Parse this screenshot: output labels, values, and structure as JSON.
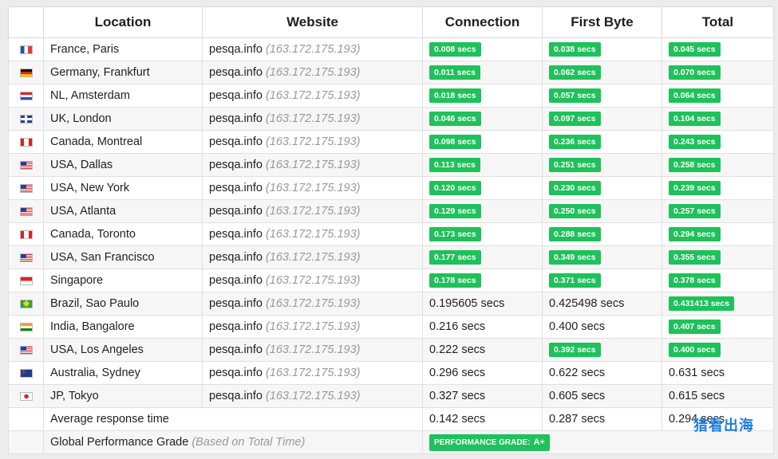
{
  "headers": [
    "Location",
    "Website",
    "Connection",
    "First Byte",
    "Total"
  ],
  "rows": [
    {
      "flag": "fr",
      "location": "France, Paris",
      "site": "pesqa.info",
      "ip": "(163.172.175.193)",
      "connection": "0.008 secs",
      "conn_badge": true,
      "first_byte": "0.038 secs",
      "fb_badge": true,
      "total": "0.045 secs",
      "total_badge": true
    },
    {
      "flag": "de",
      "location": "Germany, Frankfurt",
      "site": "pesqa.info",
      "ip": "(163.172.175.193)",
      "connection": "0.011 secs",
      "conn_badge": true,
      "first_byte": "0.062 secs",
      "fb_badge": true,
      "total": "0.070 secs",
      "total_badge": true
    },
    {
      "flag": "nl",
      "location": "NL, Amsterdam",
      "site": "pesqa.info",
      "ip": "(163.172.175.193)",
      "connection": "0.018 secs",
      "conn_badge": true,
      "first_byte": "0.057 secs",
      "fb_badge": true,
      "total": "0.064 secs",
      "total_badge": true
    },
    {
      "flag": "uk",
      "location": "UK, London",
      "site": "pesqa.info",
      "ip": "(163.172.175.193)",
      "connection": "0.046 secs",
      "conn_badge": true,
      "first_byte": "0.097 secs",
      "fb_badge": true,
      "total": "0.104 secs",
      "total_badge": true
    },
    {
      "flag": "ca",
      "location": "Canada, Montreal",
      "site": "pesqa.info",
      "ip": "(163.172.175.193)",
      "connection": "0.098 secs",
      "conn_badge": true,
      "first_byte": "0.236 secs",
      "fb_badge": true,
      "total": "0.243 secs",
      "total_badge": true
    },
    {
      "flag": "us",
      "location": "USA, Dallas",
      "site": "pesqa.info",
      "ip": "(163.172.175.193)",
      "connection": "0.113 secs",
      "conn_badge": true,
      "first_byte": "0.251 secs",
      "fb_badge": true,
      "total": "0.258 secs",
      "total_badge": true
    },
    {
      "flag": "us",
      "location": "USA, New York",
      "site": "pesqa.info",
      "ip": "(163.172.175.193)",
      "connection": "0.120 secs",
      "conn_badge": true,
      "first_byte": "0.230 secs",
      "fb_badge": true,
      "total": "0.239 secs",
      "total_badge": true
    },
    {
      "flag": "us",
      "location": "USA, Atlanta",
      "site": "pesqa.info",
      "ip": "(163.172.175.193)",
      "connection": "0.129 secs",
      "conn_badge": true,
      "first_byte": "0.250 secs",
      "fb_badge": true,
      "total": "0.257 secs",
      "total_badge": true
    },
    {
      "flag": "ca",
      "location": "Canada, Toronto",
      "site": "pesqa.info",
      "ip": "(163.172.175.193)",
      "connection": "0.173 secs",
      "conn_badge": true,
      "first_byte": "0.288 secs",
      "fb_badge": true,
      "total": "0.294 secs",
      "total_badge": true
    },
    {
      "flag": "us",
      "location": "USA, San Francisco",
      "site": "pesqa.info",
      "ip": "(163.172.175.193)",
      "connection": "0.177 secs",
      "conn_badge": true,
      "first_byte": "0.349 secs",
      "fb_badge": true,
      "total": "0.355 secs",
      "total_badge": true
    },
    {
      "flag": "sg",
      "location": "Singapore",
      "site": "pesqa.info",
      "ip": "(163.172.175.193)",
      "connection": "0.178 secs",
      "conn_badge": true,
      "first_byte": "0.371 secs",
      "fb_badge": true,
      "total": "0.378 secs",
      "total_badge": true
    },
    {
      "flag": "br",
      "location": "Brazil, Sao Paulo",
      "site": "pesqa.info",
      "ip": "(163.172.175.193)",
      "connection": "0.195605 secs",
      "conn_badge": false,
      "first_byte": "0.425498 secs",
      "fb_badge": false,
      "total": "0.431413 secs",
      "total_badge": true
    },
    {
      "flag": "in",
      "location": "India, Bangalore",
      "site": "pesqa.info",
      "ip": "(163.172.175.193)",
      "connection": "0.216 secs",
      "conn_badge": false,
      "first_byte": "0.400 secs",
      "fb_badge": false,
      "total": "0.407 secs",
      "total_badge": true
    },
    {
      "flag": "us",
      "location": "USA, Los Angeles",
      "site": "pesqa.info",
      "ip": "(163.172.175.193)",
      "connection": "0.222 secs",
      "conn_badge": false,
      "first_byte": "0.392 secs",
      "fb_badge": true,
      "total": "0.400 secs",
      "total_badge": true
    },
    {
      "flag": "au",
      "location": "Australia, Sydney",
      "site": "pesqa.info",
      "ip": "(163.172.175.193)",
      "connection": "0.296 secs",
      "conn_badge": false,
      "first_byte": "0.622 secs",
      "fb_badge": false,
      "total": "0.631 secs",
      "total_badge": false
    },
    {
      "flag": "jp",
      "location": "JP, Tokyo",
      "site": "pesqa.info",
      "ip": "(163.172.175.193)",
      "connection": "0.327 secs",
      "conn_badge": false,
      "first_byte": "0.605 secs",
      "fb_badge": false,
      "total": "0.615 secs",
      "total_badge": false
    }
  ],
  "average": {
    "label": "Average response time",
    "connection": "0.142 secs",
    "first_byte": "0.287 secs",
    "total": "0.294 secs"
  },
  "grade": {
    "label": "Global Performance Grade",
    "note": "(Based on Total Time)",
    "badge_label": "PERFORMANCE GRADE:",
    "badge_value": "A+"
  },
  "watermark": "猎看出海",
  "colors": {
    "badge_green": "#1ec15a",
    "ip_gray": "#999999",
    "watermark_blue": "#1f7de0"
  }
}
